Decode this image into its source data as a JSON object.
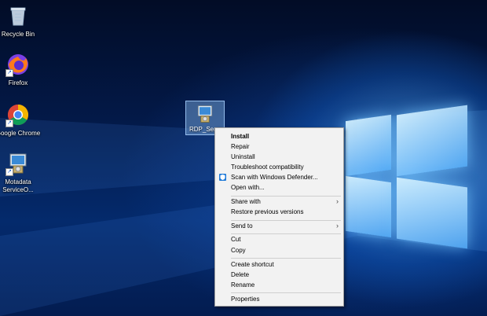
{
  "desktop_icons": [
    {
      "label": "Recycle Bin",
      "icon": "recycle-bin-icon"
    },
    {
      "label": "Firefox",
      "icon": "firefox-icon"
    },
    {
      "label": "Google Chrome",
      "icon": "chrome-icon"
    },
    {
      "label": "Motadata ServiceO...",
      "icon": "installer-icon"
    }
  ],
  "selected_file": {
    "label": "RDP_Serve",
    "icon": "installer-icon"
  },
  "context_menu": {
    "items": {
      "install": "Install",
      "repair": "Repair",
      "uninstall": "Uninstall",
      "troubleshoot": "Troubleshoot compatibility",
      "scan": "Scan with Windows Defender...",
      "open_with": "Open with...",
      "share_with": "Share with",
      "restore": "Restore previous versions",
      "send_to": "Send to",
      "cut": "Cut",
      "copy": "Copy",
      "create_shortcut": "Create shortcut",
      "delete": "Delete",
      "rename": "Rename",
      "properties": "Properties"
    },
    "submenu_arrow": "›",
    "scan_icon": "windows-defender-icon"
  },
  "colors": {
    "menu_bg": "#f2f2f2",
    "desktop_accent": "#0a5ad6",
    "selection": "#82b4e6"
  }
}
